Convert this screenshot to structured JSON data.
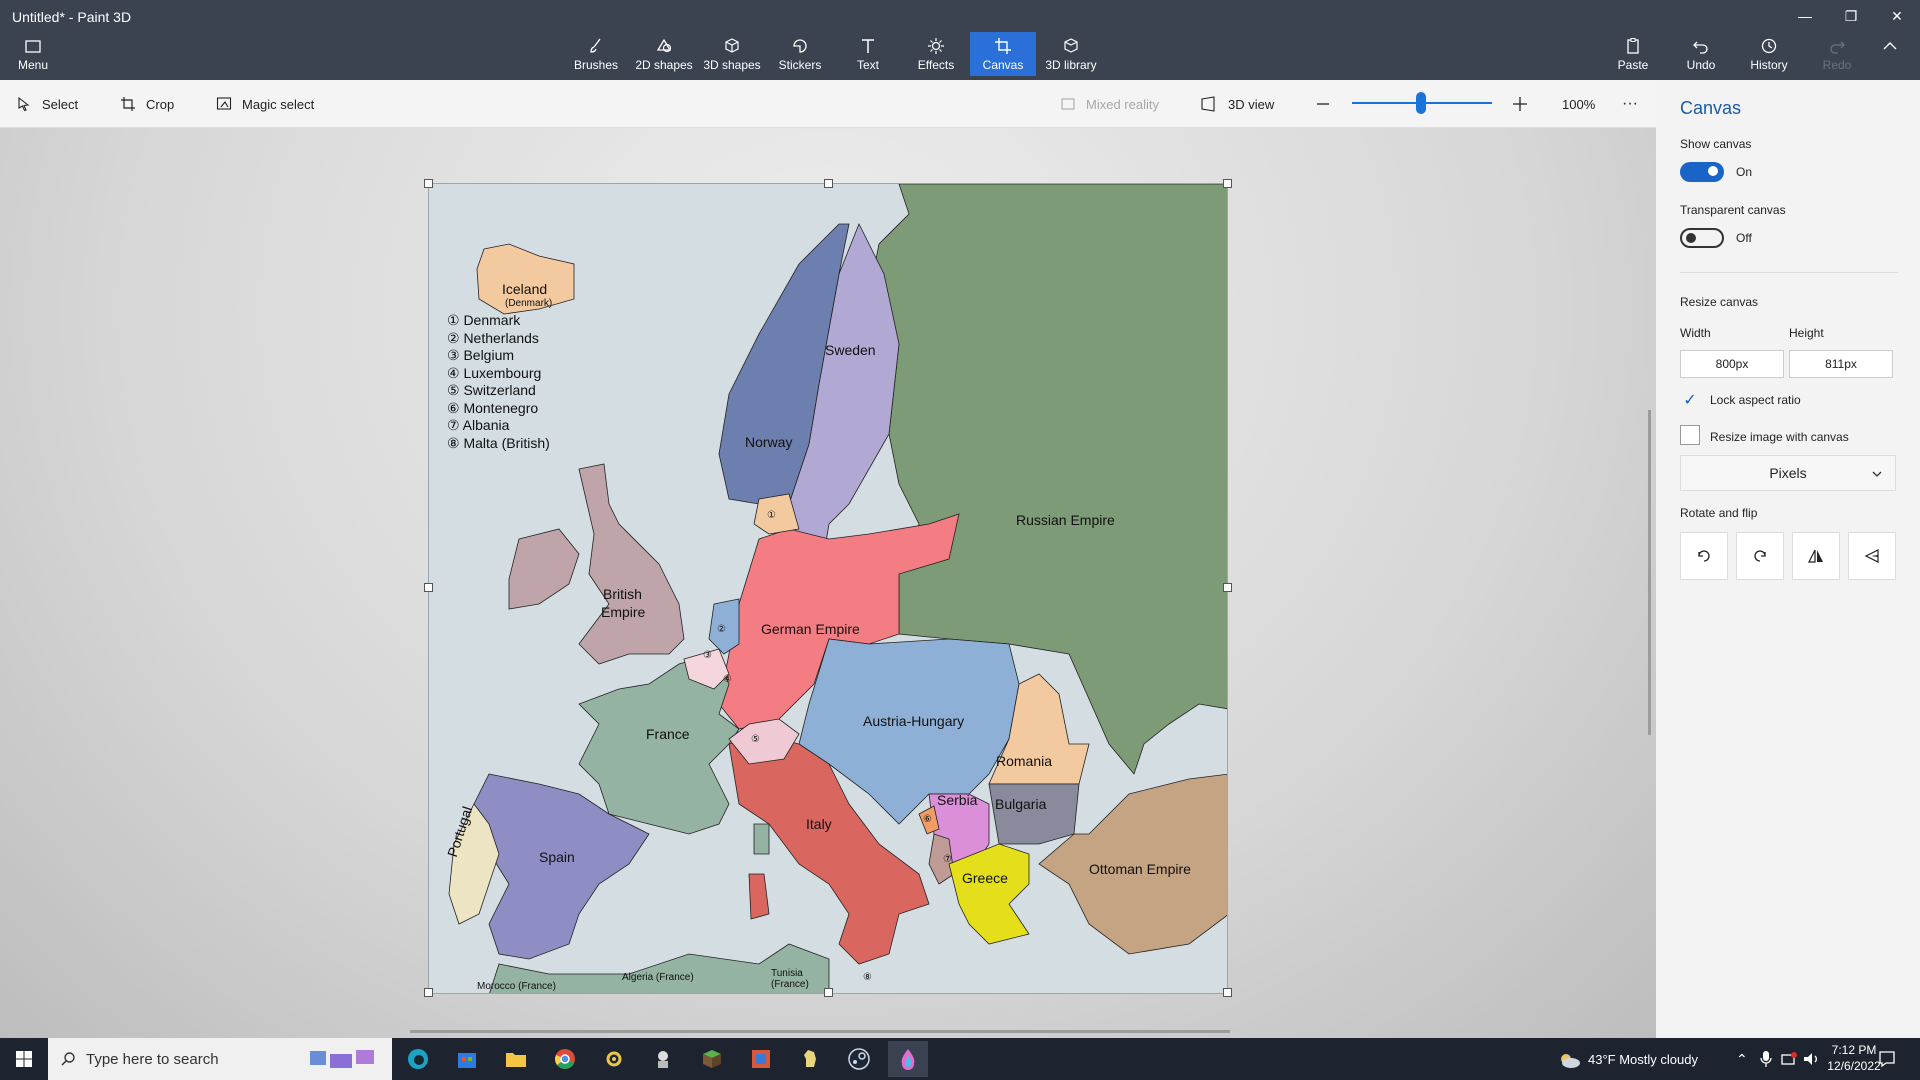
{
  "window": {
    "title": "Untitled* - Paint 3D",
    "controls": [
      "—",
      "❐",
      "✕"
    ]
  },
  "ribbon": {
    "menu_label": "Menu",
    "tools": [
      {
        "label": "Brushes"
      },
      {
        "label": "2D shapes"
      },
      {
        "label": "3D shapes"
      },
      {
        "label": "Stickers"
      },
      {
        "label": "Text"
      },
      {
        "label": "Effects"
      },
      {
        "label": "Canvas",
        "active": true
      },
      {
        "label": "3D library"
      }
    ],
    "right": [
      {
        "label": "Paste"
      },
      {
        "label": "Undo"
      },
      {
        "label": "History"
      },
      {
        "label": "Redo",
        "disabled": true
      }
    ]
  },
  "toolbar": {
    "select": "Select",
    "crop": "Crop",
    "magic_select": "Magic select",
    "mixed_reality": "Mixed reality",
    "view_3d": "3D view",
    "zoom": "100%",
    "zoom_level": 0.58,
    "more": "···"
  },
  "canvas_panel": {
    "title": "Canvas",
    "show_canvas_label": "Show canvas",
    "show_canvas_state": "On",
    "transparent_label": "Transparent canvas",
    "transparent_state": "Off",
    "resize_label": "Resize canvas",
    "width_label": "Width",
    "height_label": "Height",
    "width_value": "800px",
    "height_value": "811px",
    "lock_aspect": "Lock aspect ratio",
    "resize_image": "Resize image with canvas",
    "units": "Pixels",
    "rotate_label": "Rotate and flip"
  },
  "map": {
    "legend": [
      "① Denmark",
      "② Netherlands",
      "③ Belgium",
      "④ Luxembourg",
      "⑤ Switzerland",
      "⑥ Montenegro",
      "⑦ Albania",
      "⑧ Malta (British)"
    ],
    "labels": {
      "iceland": "Iceland",
      "iceland_sub": "(Denmark)",
      "sweden": "Sweden",
      "norway": "Norway",
      "russia": "Russian Empire",
      "british1": "British",
      "british2": "Empire",
      "germany": "German Empire",
      "france": "France",
      "austria": "Austria-Hungary",
      "romania": "Romania",
      "serbia": "Serbia",
      "bulgaria": "Bulgaria",
      "italy": "Italy",
      "spain": "Spain",
      "portugal": "Portugal",
      "greece": "Greece",
      "ottoman": "Ottoman Empire",
      "morocco": "Morocco (France)",
      "algeria": "Algeria (France)",
      "tunisia1": "Tunisia",
      "tunisia2": "(France)",
      "n1": "①",
      "n2": "②",
      "n3": "③",
      "n4": "④",
      "n5": "⑤",
      "n6": "⑥",
      "n7": "⑦",
      "n8": "⑧"
    },
    "colors": {
      "sea": "#d4dde2",
      "russia": "#7c9b76",
      "germany": "#f47d83",
      "austria": "#8fb0d6",
      "france": "#94b3a2",
      "spain": "#8e8ec4",
      "italy": "#d9665f",
      "sweden": "#b1a8d4",
      "norway": "#6d7fae",
      "british": "#bfa5a9",
      "ottoman": "#c4a482",
      "greece": "#e4df1a",
      "romania": "#f3caa0",
      "bulgaria": "#8a8a9d",
      "serbia": "#dc8fd9"
    }
  },
  "taskbar": {
    "search_placeholder": "Type here to search",
    "weather": "43°F  Mostly cloudy",
    "time": "7:12 PM",
    "date": "12/6/2022"
  }
}
